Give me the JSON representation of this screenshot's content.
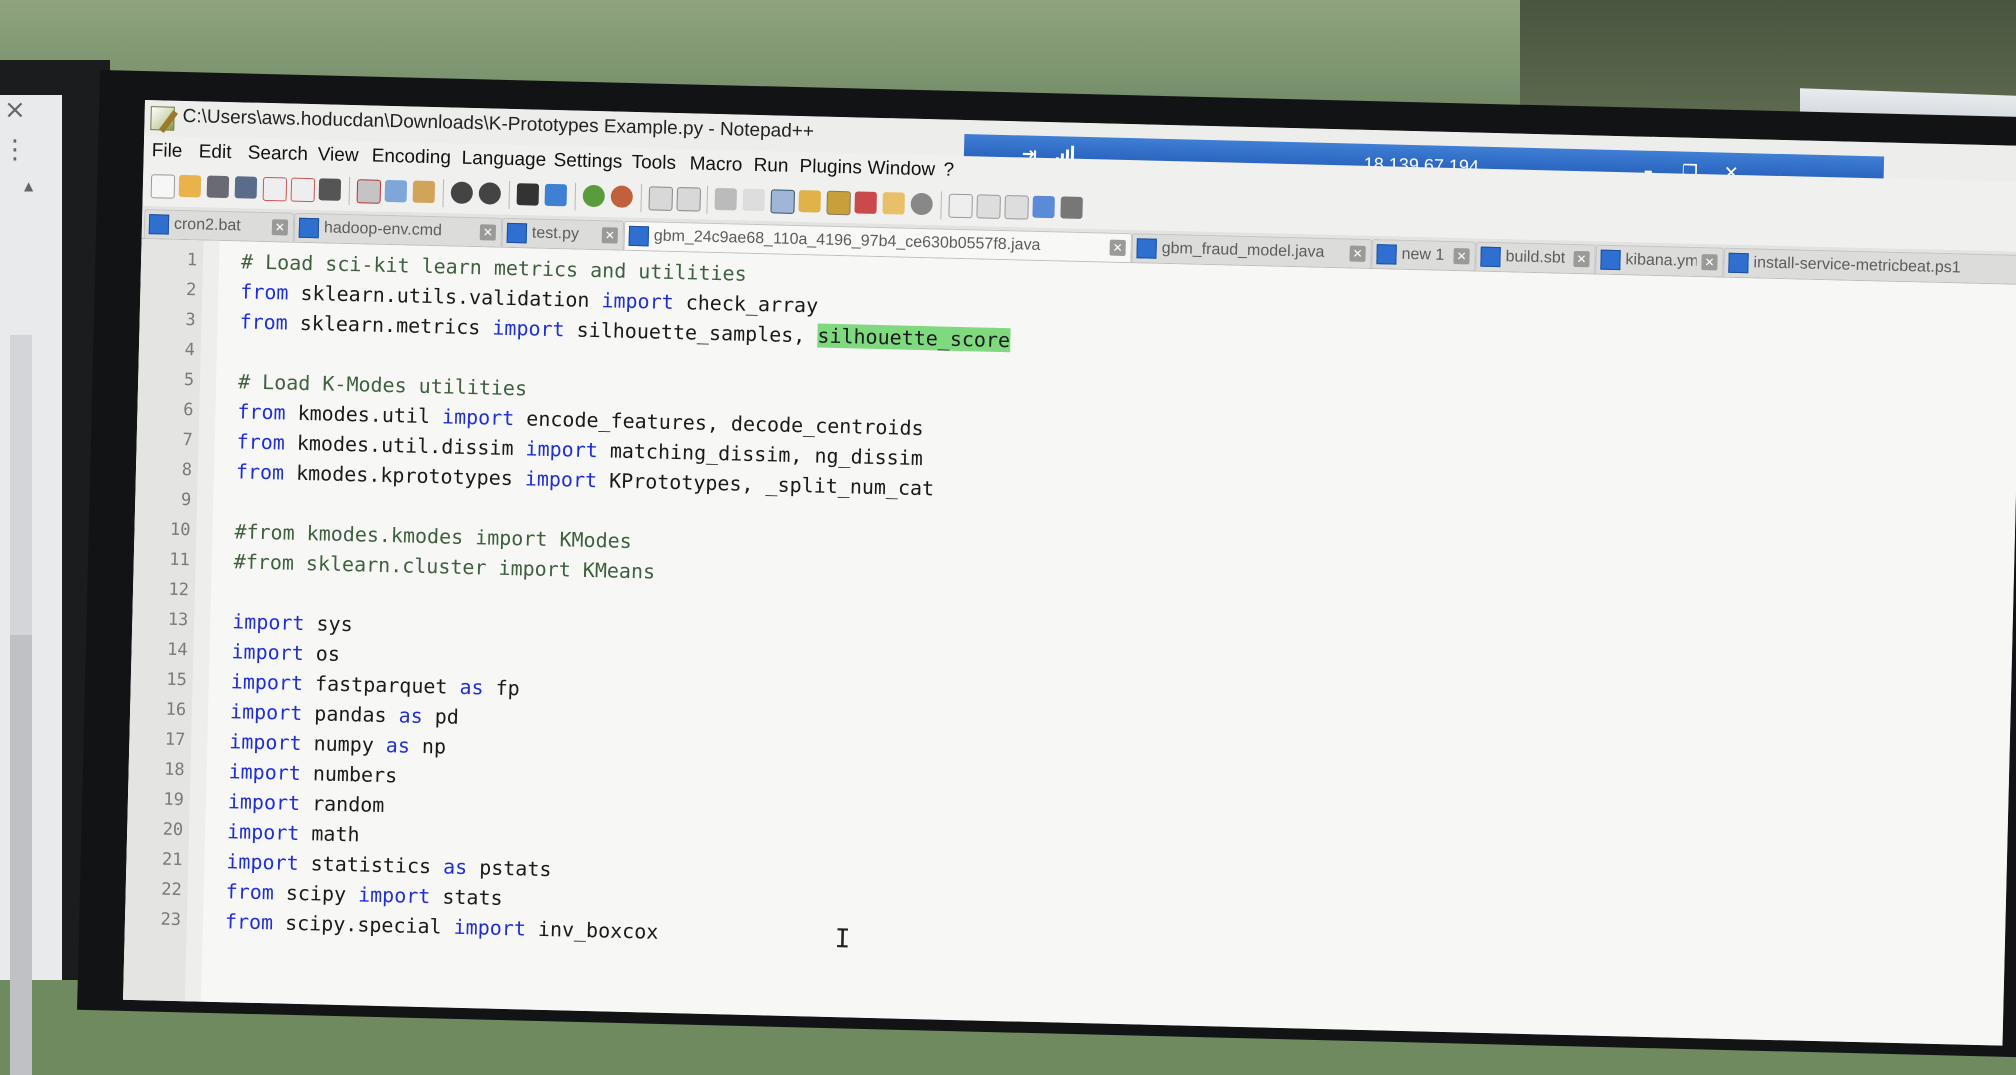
{
  "window": {
    "title": "C:\\Users\\aws.hoducdan\\Downloads\\K-Prototypes Example.py - Notepad++"
  },
  "remote_session": {
    "pin_glyph": "⇥",
    "ip": "18.139.67.194",
    "min_glyph": "–",
    "restore_glyph": "❐",
    "close_glyph": "✕"
  },
  "menu": [
    "File",
    "Edit",
    "Search",
    "View",
    "Encoding",
    "Language",
    "Settings",
    "Tools",
    "Macro",
    "Run",
    "Plugins",
    "Window",
    "?"
  ],
  "toolbar": {
    "icons": [
      "new-file-icon",
      "open-file-icon",
      "save-icon",
      "save-all-icon",
      "close-icon",
      "close-all-icon",
      "print-icon",
      "cut-icon",
      "copy-icon",
      "paste-icon",
      "undo-icon",
      "redo-icon",
      "find-icon",
      "replace-icon",
      "zoom-in-icon",
      "zoom-out-icon",
      "sync-vertical-icon",
      "sync-horizontal-icon",
      "word-wrap-icon",
      "show-all-chars-icon",
      "indent-guide-icon",
      "language-icon",
      "udl-icon",
      "function-list-icon",
      "folder-workspace-icon",
      "monitoring-icon",
      "record-macro-icon",
      "stop-macro-icon",
      "play-macro-icon",
      "run-macro-multiple-icon",
      "save-macro-icon"
    ]
  },
  "tabs": [
    {
      "label": "cron2.bat",
      "close": "✕"
    },
    {
      "label": "hadoop-env.cmd",
      "close": "✕"
    },
    {
      "label": "test.py",
      "close": "✕"
    },
    {
      "label": "gbm_24c9ae68_110a_4196_97b4_ce630b0557f8.java",
      "close": "✕"
    },
    {
      "label": "gbm_fraud_model.java",
      "close": "✕"
    },
    {
      "label": "new 1",
      "close": "✕"
    },
    {
      "label": "build.sbt",
      "close": "✕"
    },
    {
      "label": "kibana.yml",
      "close": "✕"
    },
    {
      "label": "install-service-metricbeat.ps1",
      "close": ""
    }
  ],
  "editor": {
    "lines": [
      {
        "n": "1",
        "parts": [
          {
            "t": "# Load sci-kit learn metrics and utilities",
            "c": "cm"
          }
        ]
      },
      {
        "n": "2",
        "parts": [
          {
            "t": "from",
            "c": "kw"
          },
          {
            "t": " sklearn.utils.validation ",
            "c": ""
          },
          {
            "t": "import",
            "c": "kw"
          },
          {
            "t": " check_array",
            "c": ""
          }
        ]
      },
      {
        "n": "3",
        "parts": [
          {
            "t": "from",
            "c": "kw"
          },
          {
            "t": " sklearn.metrics ",
            "c": ""
          },
          {
            "t": "import",
            "c": "kw"
          },
          {
            "t": " silhouette_samples, ",
            "c": ""
          },
          {
            "t": "silhouette_score",
            "c": "hl"
          }
        ]
      },
      {
        "n": "4",
        "parts": []
      },
      {
        "n": "5",
        "parts": [
          {
            "t": "# Load K-Modes utilities",
            "c": "cm"
          }
        ]
      },
      {
        "n": "6",
        "parts": [
          {
            "t": "from",
            "c": "kw"
          },
          {
            "t": " kmodes.util ",
            "c": ""
          },
          {
            "t": "import",
            "c": "kw"
          },
          {
            "t": " encode_features, decode_centroids",
            "c": ""
          }
        ]
      },
      {
        "n": "7",
        "parts": [
          {
            "t": "from",
            "c": "kw"
          },
          {
            "t": " kmodes.util.dissim ",
            "c": ""
          },
          {
            "t": "import",
            "c": "kw"
          },
          {
            "t": " matching_dissim, ng_dissim",
            "c": ""
          }
        ]
      },
      {
        "n": "8",
        "parts": [
          {
            "t": "from",
            "c": "kw"
          },
          {
            "t": " kmodes.kprototypes ",
            "c": ""
          },
          {
            "t": "import",
            "c": "kw"
          },
          {
            "t": " KPrototypes, _split_num_cat",
            "c": ""
          }
        ]
      },
      {
        "n": "9",
        "parts": []
      },
      {
        "n": "10",
        "parts": [
          {
            "t": "#from kmodes.kmodes import KModes",
            "c": "cm"
          }
        ]
      },
      {
        "n": "11",
        "parts": [
          {
            "t": "#from sklearn.cluster import KMeans",
            "c": "cm"
          }
        ]
      },
      {
        "n": "12",
        "parts": []
      },
      {
        "n": "13",
        "parts": [
          {
            "t": "import",
            "c": "kw"
          },
          {
            "t": " sys",
            "c": ""
          }
        ]
      },
      {
        "n": "14",
        "parts": [
          {
            "t": "import",
            "c": "kw"
          },
          {
            "t": " os",
            "c": ""
          }
        ]
      },
      {
        "n": "15",
        "parts": [
          {
            "t": "import",
            "c": "kw"
          },
          {
            "t": " fastparquet ",
            "c": ""
          },
          {
            "t": "as",
            "c": "kw"
          },
          {
            "t": " fp",
            "c": ""
          }
        ]
      },
      {
        "n": "16",
        "parts": [
          {
            "t": "import",
            "c": "kw"
          },
          {
            "t": " pandas ",
            "c": ""
          },
          {
            "t": "as",
            "c": "kw"
          },
          {
            "t": " pd",
            "c": ""
          }
        ]
      },
      {
        "n": "17",
        "parts": [
          {
            "t": "import",
            "c": "kw"
          },
          {
            "t": " numpy ",
            "c": ""
          },
          {
            "t": "as",
            "c": "kw"
          },
          {
            "t": " np",
            "c": ""
          }
        ]
      },
      {
        "n": "18",
        "parts": [
          {
            "t": "import",
            "c": "kw"
          },
          {
            "t": " numbers",
            "c": ""
          }
        ]
      },
      {
        "n": "19",
        "parts": [
          {
            "t": "import",
            "c": "kw"
          },
          {
            "t": " random",
            "c": ""
          }
        ]
      },
      {
        "n": "20",
        "parts": [
          {
            "t": "import",
            "c": "kw"
          },
          {
            "t": " math",
            "c": ""
          }
        ]
      },
      {
        "n": "21",
        "parts": [
          {
            "t": "import",
            "c": "kw"
          },
          {
            "t": " statistics ",
            "c": ""
          },
          {
            "t": "as",
            "c": "kw"
          },
          {
            "t": " pstats",
            "c": ""
          }
        ]
      },
      {
        "n": "22",
        "parts": [
          {
            "t": "from",
            "c": "kw"
          },
          {
            "t": " scipy ",
            "c": ""
          },
          {
            "t": "import",
            "c": "kw"
          },
          {
            "t": " stats",
            "c": ""
          }
        ]
      },
      {
        "n": "23",
        "parts": [
          {
            "t": "from",
            "c": "kw"
          },
          {
            "t": " scipy.special ",
            "c": ""
          },
          {
            "t": "import",
            "c": "kw"
          },
          {
            "t": " inv_boxcox",
            "c": ""
          }
        ]
      }
    ],
    "cursor_glyph": "I"
  },
  "left_monitor": {
    "close_glyph": "×",
    "menu_glyph": "⋮",
    "scroll_up_glyph": "▲"
  },
  "colors": {
    "keyword": "#1f2fd8",
    "comment": "#3f5f3f",
    "highlight": "#7fd97f",
    "rdp_bar": "#2a64c0"
  }
}
